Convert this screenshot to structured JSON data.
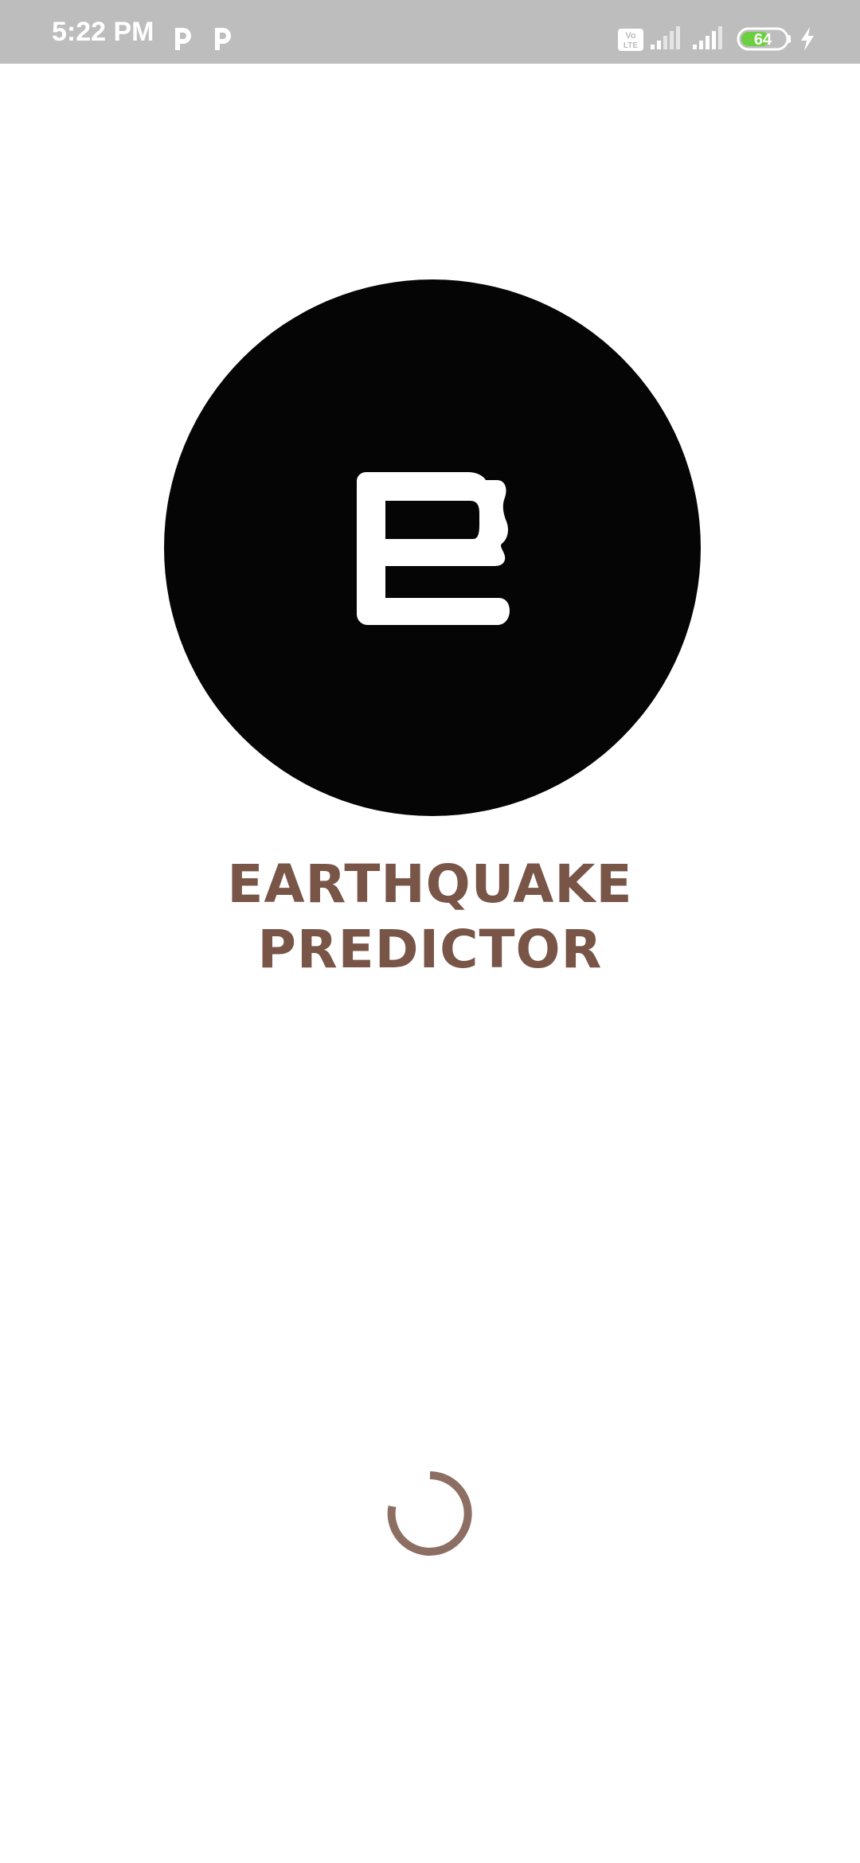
{
  "status_bar": {
    "time": "5:22 PM",
    "notification_icons": [
      "p-app-icon",
      "p-app-icon"
    ],
    "volte_label": "Vo LTE",
    "battery_level": "64",
    "battery_percent": 64,
    "charging": true,
    "colors": {
      "background": "#bdbdbd",
      "battery_fill": "#6ccf3f"
    }
  },
  "splash": {
    "logo_icon": "e-logo-icon",
    "title_line1": "EARTHQUAKE",
    "title_line2": "PREDICTOR",
    "colors": {
      "title": "#795548",
      "logo_bg": "#050505",
      "spinner": "#8d6e63"
    },
    "loading_indicator": "progress-spinner"
  }
}
